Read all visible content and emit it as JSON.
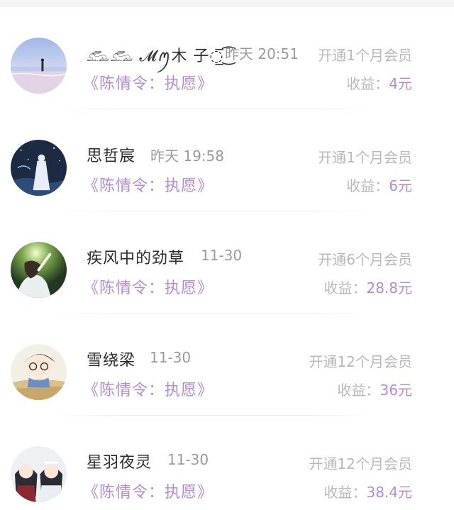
{
  "rows": [
    {
      "name": "𓃹𓃹 𝓜ꪑ木 子◌̲̅ ͜͡",
      "time": "昨天 20:51",
      "book": "《陈情令：执愿》",
      "plan": "开通1个月会员",
      "earn_label": "收益：",
      "earn_amount": "4元"
    },
    {
      "name": "思哲宸",
      "time": "昨天 19:58",
      "book": "《陈情令：执愿》",
      "plan": "开通1个月会员",
      "earn_label": "收益：",
      "earn_amount": "6元"
    },
    {
      "name": "疾风中的劲草",
      "time": "11-30",
      "book": "《陈情令：执愿》",
      "plan": "开通6个月会员",
      "earn_label": "收益：",
      "earn_amount": "28.8元"
    },
    {
      "name": "雪绕梁",
      "time": "11-30",
      "book": "《陈情令：执愿》",
      "plan": "开通12个月会员",
      "earn_label": "收益：",
      "earn_amount": "36元"
    },
    {
      "name": "星羽夜灵",
      "time": "11-30",
      "book": "《陈情令：执愿》",
      "plan": "开通12个月会员",
      "earn_label": "收益：",
      "earn_amount": "38.4元"
    }
  ],
  "colors": {
    "accent": "#b48ad8",
    "muted": "#b8b8b8",
    "name": "#2b2b2b",
    "time": "#9a9a9a"
  }
}
